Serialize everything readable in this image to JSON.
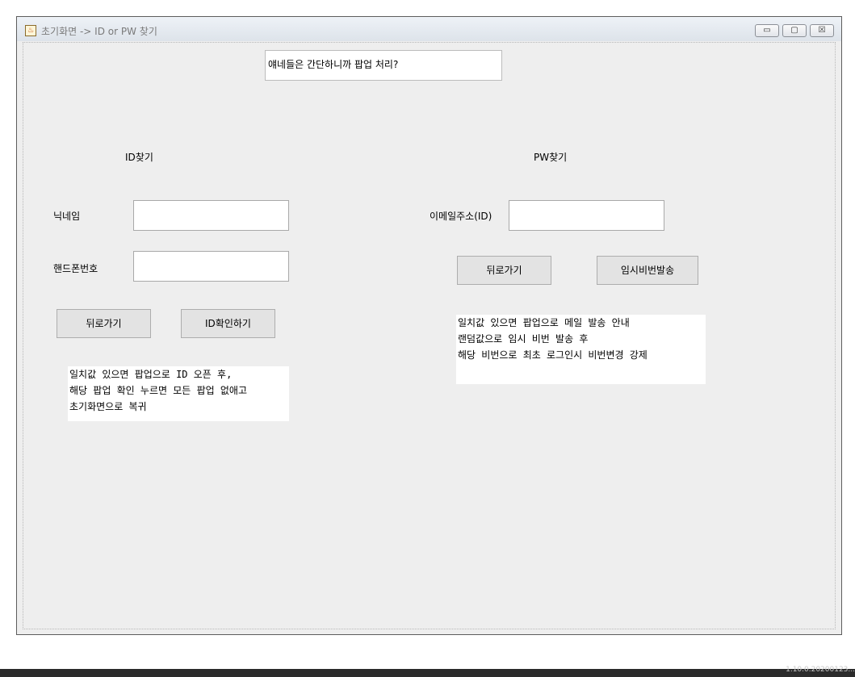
{
  "window": {
    "title": "초기화면 -> ID or PW 찾기",
    "app_icon": "java-icon",
    "controls": {
      "minimize": "▭",
      "maximize": "▢",
      "close": "☒"
    }
  },
  "top_note": "얘네들은 간단하니까 팝업 처리?",
  "id_section": {
    "heading": "ID찾기",
    "nickname_label": "닉네임",
    "nickname_value": "",
    "phone_label": "핸드폰번호",
    "phone_value": "",
    "back_button": "뒤로가기",
    "confirm_button": "ID확인하기",
    "note_lines": "일치값 있으면 팝업으로 ID 오픈 후,\n해당 팝업 확인 누르면 모든 팝업 없애고\n초기화면으로 복귀"
  },
  "pw_section": {
    "heading": "PW찾기",
    "email_label": "이메일주소(ID)",
    "email_value": "",
    "back_button": "뒤로가기",
    "send_button": "임시비번발송",
    "note_lines": "일치값 있으면 팝업으로 메일 발송 안내\n랜덤값으로 임시 비번 발송 후\n해당 비번으로 최초 로그인시 비번변경 강제"
  },
  "taskbar": {
    "version": "1.10.0.20200123..."
  }
}
